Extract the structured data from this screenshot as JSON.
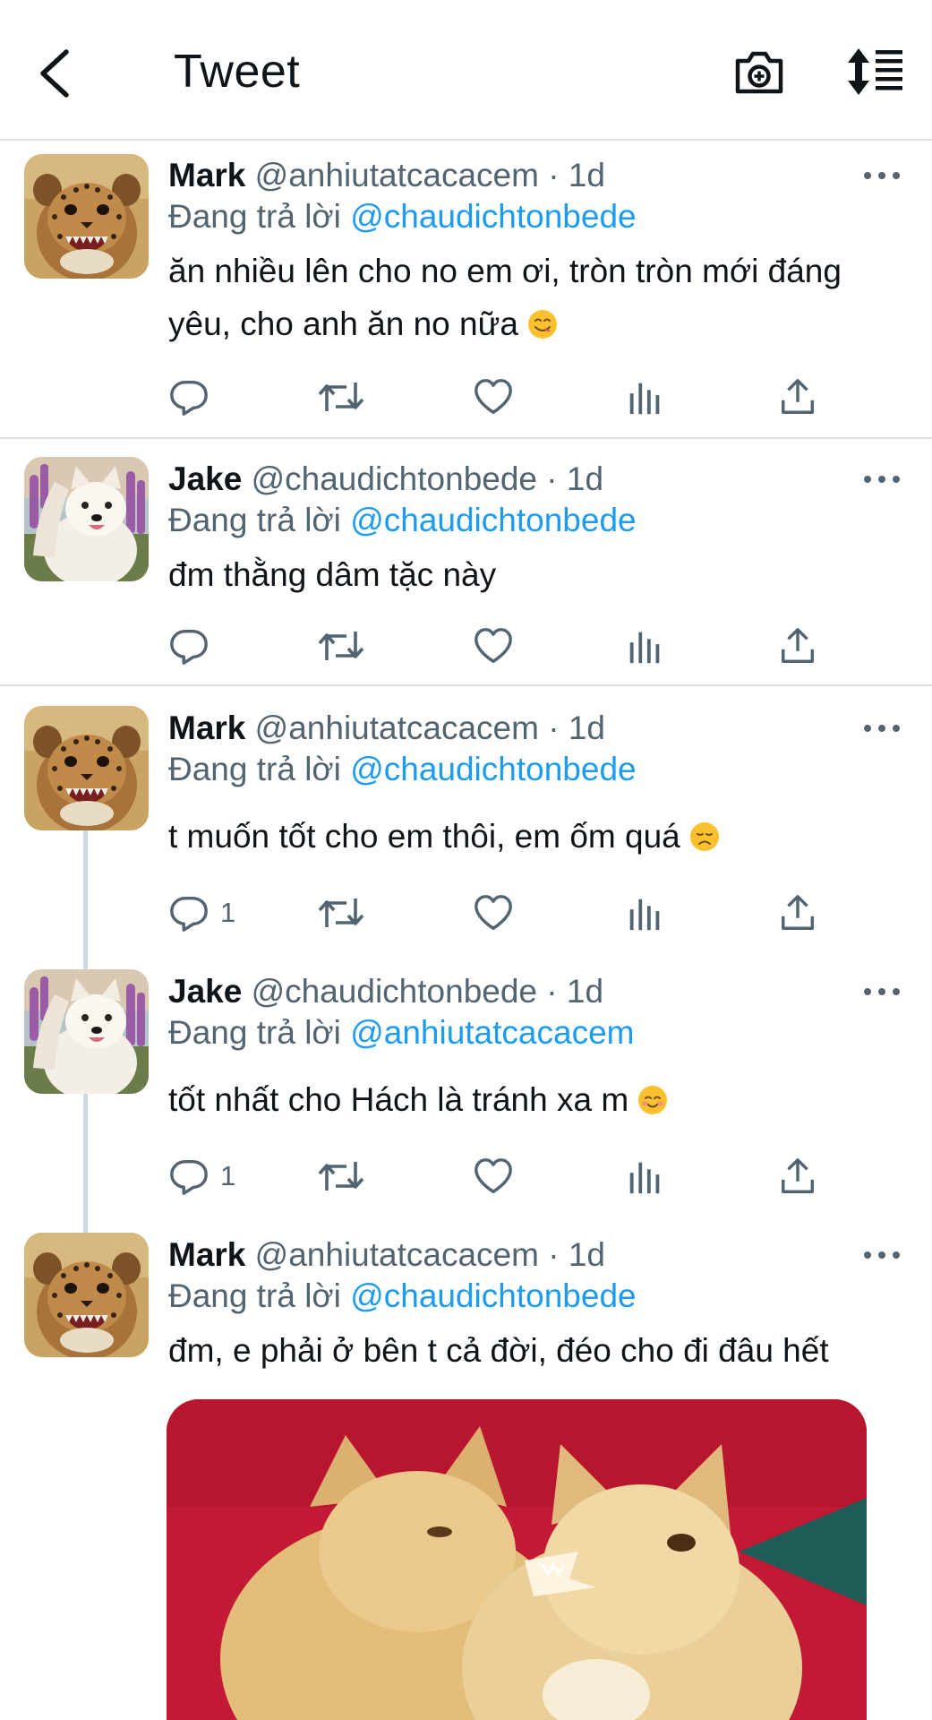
{
  "header": {
    "back_icon": "chevron-left-icon",
    "title": "Tweet",
    "camera_icon": "camera-plus-icon",
    "sort_icon": "sort-replies-icon"
  },
  "reply_prefix": "Đang trả lời",
  "tweets": [
    {
      "name": "Mark",
      "handle": "@anhiutatcacacem",
      "dot": "·",
      "time": "1d",
      "replying_to": "@chaudichtonbede",
      "text_line1": "ăn nhiều lên cho no em ơi, tròn tròn mới đáng",
      "text_line2": "yêu, cho anh ăn no nữa",
      "emoji": "yum-face-emoji",
      "avatar": "cheetah-cub-avatar",
      "reply_count": "",
      "retweet_count": "",
      "like_count": ""
    },
    {
      "name": "Jake",
      "handle": "@chaudichtonbede",
      "dot": "·",
      "time": "1d",
      "replying_to": "@chaudichtonbede",
      "text": "đm thằng dâm tặc này",
      "avatar": "white-dog-avatar",
      "reply_count": ""
    },
    {
      "name": "Mark",
      "handle": "@anhiutatcacacem",
      "dot": "·",
      "time": "1d",
      "replying_to": "@chaudichtonbede",
      "text": "t muốn tốt cho em thôi, em ốm quá",
      "emoji": "disappointed-face-emoji",
      "avatar": "cheetah-cub-avatar",
      "reply_count": "1"
    },
    {
      "name": "Jake",
      "handle": "@chaudichtonbede",
      "dot": "·",
      "time": "1d",
      "replying_to": "@anhiutatcacacem",
      "text": "tốt nhất cho Hách là tránh xa m",
      "emoji": "smiling-blush-emoji",
      "avatar": "white-dog-avatar",
      "reply_count": "1"
    },
    {
      "name": "Mark",
      "handle": "@anhiutatcacacem",
      "dot": "·",
      "time": "1d",
      "replying_to": "@chaudichtonbede",
      "text": "đm, e phải ở bên t cả đời, đéo cho đi đâu hết",
      "avatar": "cheetah-cub-avatar",
      "media": "two-kittens-photo"
    }
  ],
  "action_icons": [
    "reply-icon",
    "retweet-icon",
    "like-icon",
    "analytics-icon",
    "share-icon"
  ],
  "colors": {
    "text": "#0f1419",
    "secondary": "#536471",
    "mention": "#1d9bf0",
    "divider": "#dcdfe2",
    "thread_line": "#cfd9de"
  }
}
